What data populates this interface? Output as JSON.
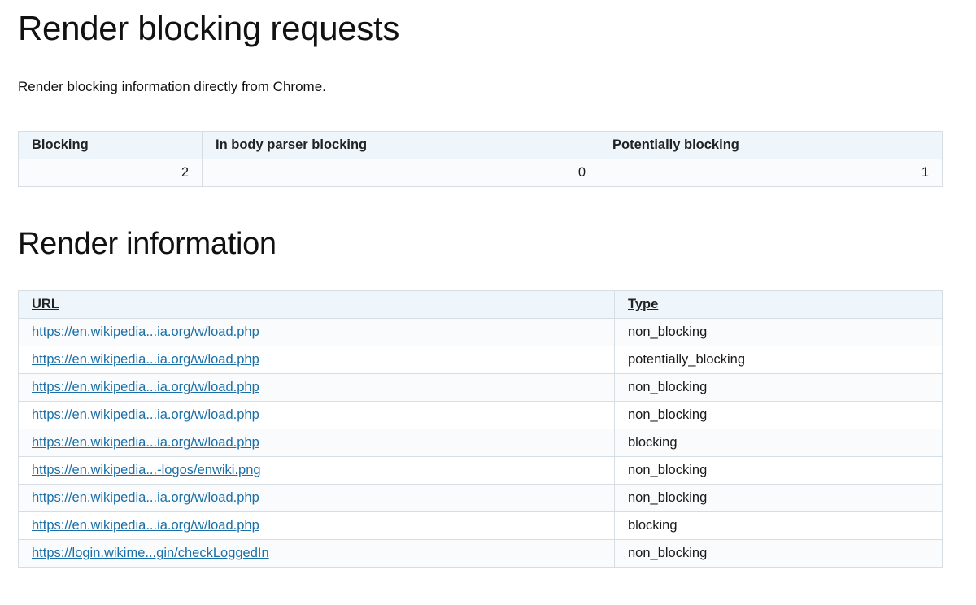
{
  "page": {
    "title": "Render blocking requests",
    "description": "Render blocking information directly from Chrome."
  },
  "summary": {
    "headers": [
      "Blocking",
      "In body parser blocking",
      "Potentially blocking"
    ],
    "values": [
      "2",
      "0",
      "1"
    ]
  },
  "render_info": {
    "title": "Render information",
    "headers": [
      "URL",
      "Type"
    ],
    "rows": [
      {
        "url": "https://en.wikipedia...ia.org/w/load.php",
        "type": "non_blocking"
      },
      {
        "url": "https://en.wikipedia...ia.org/w/load.php",
        "type": "potentially_blocking"
      },
      {
        "url": "https://en.wikipedia...ia.org/w/load.php",
        "type": "non_blocking"
      },
      {
        "url": "https://en.wikipedia...ia.org/w/load.php",
        "type": "non_blocking"
      },
      {
        "url": "https://en.wikipedia...ia.org/w/load.php",
        "type": "blocking"
      },
      {
        "url": "https://en.wikipedia...-logos/enwiki.png",
        "type": "non_blocking"
      },
      {
        "url": "https://en.wikipedia...ia.org/w/load.php",
        "type": "non_blocking"
      },
      {
        "url": "https://en.wikipedia...ia.org/w/load.php",
        "type": "blocking"
      },
      {
        "url": "https://login.wikime...gin/checkLoggedIn",
        "type": "non_blocking"
      }
    ]
  }
}
